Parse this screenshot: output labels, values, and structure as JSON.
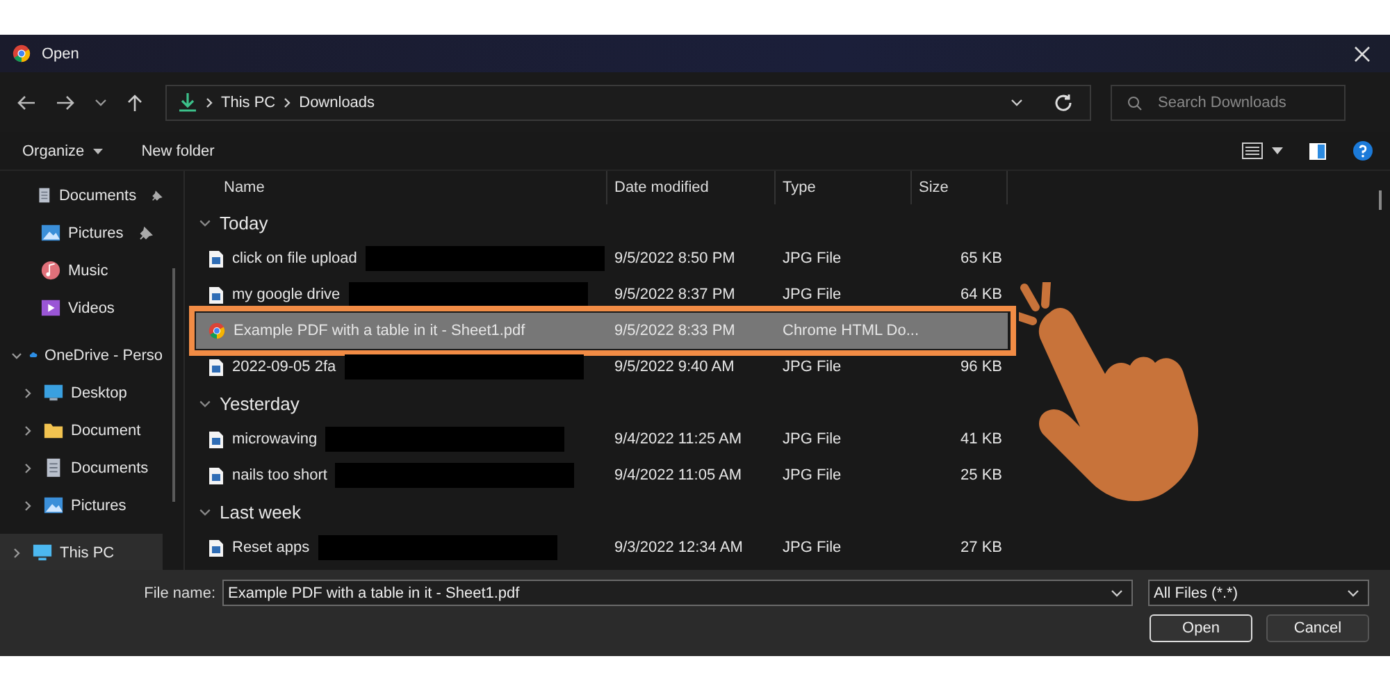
{
  "window": {
    "title": "Open"
  },
  "address": {
    "path": [
      "This PC",
      "Downloads"
    ]
  },
  "search": {
    "placeholder": "Search Downloads"
  },
  "toolbar": {
    "organize": "Organize",
    "new_folder": "New folder"
  },
  "sidebar": {
    "items": [
      {
        "label": "Documents",
        "kind": "documents",
        "pinned": true,
        "selected": false
      },
      {
        "label": "Pictures",
        "kind": "pictures",
        "pinned": true,
        "selected": false
      },
      {
        "label": "Music",
        "kind": "music",
        "pinned": false,
        "selected": false
      },
      {
        "label": "Videos",
        "kind": "videos",
        "pinned": false,
        "selected": false
      },
      {
        "label": "OneDrive - Perso",
        "kind": "cloud",
        "expanded": true,
        "selected": false,
        "children": [
          {
            "label": "Desktop",
            "kind": "desktop",
            "expanded": false,
            "selected": false
          },
          {
            "label": "Document",
            "kind": "folder",
            "expanded": false,
            "selected": false
          },
          {
            "label": "Documents",
            "kind": "documents",
            "expanded": false,
            "selected": false
          },
          {
            "label": "Pictures",
            "kind": "pictures",
            "expanded": false,
            "selected": false
          }
        ]
      },
      {
        "label": "This PC",
        "kind": "pc",
        "expanded": false,
        "selected": true
      }
    ]
  },
  "columns": [
    "Name",
    "Date modified",
    "Type",
    "Size"
  ],
  "groups": [
    {
      "label": "Today",
      "expanded": true,
      "files": [
        {
          "name": "click on file upload",
          "kind": "image",
          "redacted": true,
          "date": "9/5/2022 8:50 PM",
          "type": "JPG File",
          "size": "65 KB",
          "selected": false
        },
        {
          "name": "my google drive",
          "kind": "image",
          "redacted": true,
          "date": "9/5/2022 8:37 PM",
          "type": "JPG File",
          "size": "64 KB",
          "selected": false
        },
        {
          "name": "Example PDF with a table in it - Sheet1.pdf",
          "kind": "chrome",
          "redacted": false,
          "date": "9/5/2022 8:33 PM",
          "type": "Chrome HTML Do...",
          "selected": true
        },
        {
          "name": "2022-09-05 2fa",
          "kind": "image",
          "redacted": true,
          "date": "9/5/2022 9:40 AM",
          "type": "JPG File",
          "size": "96 KB",
          "selected": false
        }
      ]
    },
    {
      "label": "Yesterday",
      "expanded": true,
      "files": [
        {
          "name": "microwaving",
          "kind": "image",
          "redacted": true,
          "date": "9/4/2022 11:25 AM",
          "type": "JPG File",
          "size": "41 KB",
          "selected": false
        },
        {
          "name": "nails too short",
          "kind": "image",
          "redacted": true,
          "date": "9/4/2022 11:05 AM",
          "type": "JPG File",
          "size": "25 KB",
          "selected": false
        }
      ]
    },
    {
      "label": "Last week",
      "expanded": true,
      "files": [
        {
          "name": "Reset apps",
          "kind": "image",
          "redacted": true,
          "date": "9/3/2022 12:34 AM",
          "type": "JPG File",
          "size": "27 KB",
          "selected": false
        }
      ]
    }
  ],
  "file_name": {
    "label": "File name:",
    "value": "Example PDF with a table in it - Sheet1.pdf"
  },
  "filter": {
    "value": "All Files (*.*)"
  },
  "buttons": [
    "Open",
    "Cancel"
  ]
}
